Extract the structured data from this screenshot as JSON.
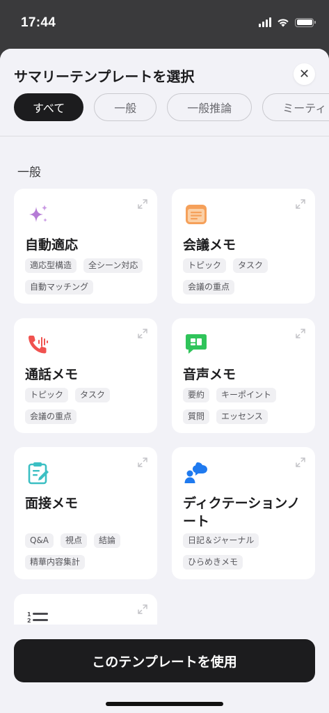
{
  "status_bar": {
    "time": "17:44"
  },
  "sheet": {
    "title": "サマリーテンプレートを選択",
    "close_label": "✕",
    "filters": [
      "すべて",
      "一般",
      "一般推論",
      "ミーティ"
    ]
  },
  "section": {
    "title": "一般"
  },
  "templates": [
    {
      "name": "自動適応",
      "icon": "sparkle-icon",
      "tags": [
        "適応型構造",
        "全シーン対応",
        "自動マッチング"
      ]
    },
    {
      "name": "会議メモ",
      "icon": "notes-icon",
      "tags": [
        "トピック",
        "タスク",
        "会議の重点"
      ]
    },
    {
      "name": "通話メモ",
      "icon": "phone-call-icon",
      "tags": [
        "トピック",
        "タスク",
        "会議の重点"
      ]
    },
    {
      "name": "音声メモ",
      "icon": "chat-bubble-icon",
      "tags": [
        "要約",
        "キーポイント",
        "質問",
        "エッセンス"
      ]
    },
    {
      "name": "面接メモ",
      "icon": "clipboard-edit-icon",
      "tags": [
        "Q&A",
        "視点",
        "結論",
        "精華内容集計"
      ]
    },
    {
      "name": "ディクテーションノート",
      "icon": "dictation-icon",
      "tags": [
        "日記＆ジャーナル",
        "ひらめきメモ"
      ]
    },
    {
      "name": "",
      "icon": "numbered-list-icon",
      "tags": []
    }
  ],
  "footer": {
    "use_button_label": "このテンプレートを使用"
  },
  "colors": {
    "sparkle": "#b57bd6",
    "notes": "#f5a05a",
    "phone": "#f0524f",
    "chat": "#2fc45a",
    "clipboard": "#3bbfc3",
    "dictation": "#1f7aef"
  }
}
